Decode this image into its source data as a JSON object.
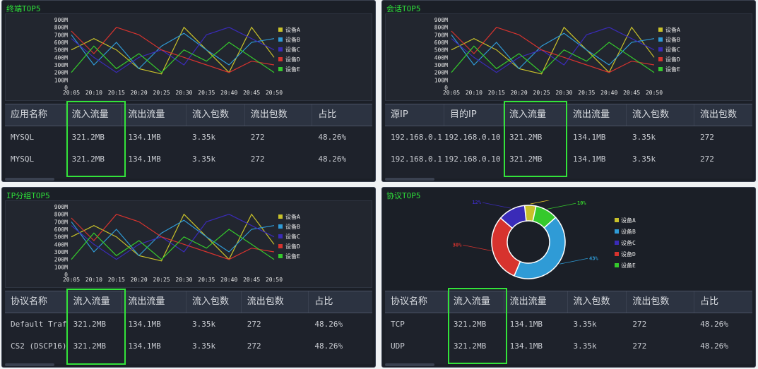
{
  "colors": {
    "series": [
      "#c8c12a",
      "#2f9bd6",
      "#3a2bb8",
      "#d7332e",
      "#35c92c"
    ],
    "highlight": "#33e33a",
    "title": "#2ee03a"
  },
  "panels": {
    "terminal": {
      "title": "终端TOP5",
      "headers": [
        "应用名称",
        "流入流量",
        "流出流量",
        "流入包数",
        "流出包数",
        "占比"
      ],
      "rows": [
        [
          "MYSQL",
          "321.2MB",
          "134.1MB",
          "3.35k",
          "272",
          "48.26%"
        ],
        [
          "MYSQL",
          "321.2MB",
          "134.1MB",
          "3.35k",
          "272",
          "48.26%"
        ]
      ]
    },
    "session": {
      "title": "会话TOP5",
      "headers": [
        "源IP",
        "目的IP",
        "流入流量",
        "流出流量",
        "流入包数",
        "流出包数"
      ],
      "rows": [
        [
          "192.168.0.1",
          "192.168.0.10",
          "321.2MB",
          "134.1MB",
          "3.35k",
          "272"
        ],
        [
          "192.168.0.1",
          "192.168.0.10",
          "321.2MB",
          "134.1MB",
          "3.35k",
          "272"
        ]
      ]
    },
    "ipgroup": {
      "title": "IP分组TOP5",
      "headers": [
        "协议名称",
        "流入流量",
        "流出流量",
        "流入包数",
        "流出包数",
        "占比"
      ],
      "rows": [
        [
          "Default Traff",
          "321.2MB",
          "134.1MB",
          "3.35k",
          "272",
          "48.26%"
        ],
        [
          "CS2 (DSCP16)",
          "321.2MB",
          "134.1MB",
          "3.35k",
          "272",
          "48.26%"
        ]
      ]
    },
    "protocol": {
      "title": "协议TOP5",
      "headers": [
        "协议名称",
        "流入流量",
        "流出流量",
        "流入包数",
        "流出包数",
        "占比"
      ],
      "rows": [
        [
          "TCP",
          "321.2MB",
          "134.1MB",
          "3.35k",
          "272",
          "48.26%"
        ],
        [
          "UDP",
          "321.2MB",
          "134.1MB",
          "3.35k",
          "272",
          "48.26%"
        ]
      ]
    }
  },
  "chart_data": [
    {
      "type": "line",
      "x": [
        "20:05",
        "20:10",
        "20:15",
        "20:20",
        "20:25",
        "20:30",
        "20:35",
        "20:40",
        "20:45",
        "20:50"
      ],
      "yticks": [
        "900M",
        "800M",
        "700M",
        "600M",
        "500M",
        "400M",
        "300M",
        "200M",
        "100M",
        "0"
      ],
      "ylim": [
        0,
        900
      ],
      "legend_position": "right",
      "series": [
        {
          "name": "设备A",
          "values": [
            500,
            650,
            500,
            250,
            180,
            800,
            500,
            200,
            800,
            400
          ]
        },
        {
          "name": "设备B",
          "values": [
            700,
            300,
            600,
            250,
            550,
            720,
            500,
            300,
            600,
            650
          ]
        },
        {
          "name": "设备C",
          "values": [
            650,
            400,
            200,
            400,
            500,
            300,
            700,
            800,
            650,
            500
          ]
        },
        {
          "name": "设备D",
          "values": [
            750,
            450,
            800,
            700,
            500,
            400,
            300,
            200,
            350,
            300
          ]
        },
        {
          "name": "设备E",
          "values": [
            200,
            550,
            250,
            450,
            200,
            500,
            350,
            600,
            400,
            200
          ]
        }
      ]
    },
    {
      "type": "line",
      "x": [
        "20:05",
        "20:10",
        "20:15",
        "20:20",
        "20:25",
        "20:30",
        "20:35",
        "20:40",
        "20:45",
        "20:50"
      ],
      "yticks": [
        "900M",
        "800M",
        "700M",
        "600M",
        "500M",
        "400M",
        "300M",
        "200M",
        "100M",
        "0"
      ],
      "ylim": [
        0,
        900
      ],
      "legend_position": "right",
      "series": [
        {
          "name": "设备A",
          "values": [
            500,
            650,
            500,
            250,
            180,
            800,
            500,
            200,
            800,
            400
          ]
        },
        {
          "name": "设备B",
          "values": [
            700,
            300,
            600,
            250,
            550,
            720,
            500,
            300,
            600,
            650
          ]
        },
        {
          "name": "设备C",
          "values": [
            650,
            400,
            200,
            400,
            500,
            300,
            700,
            800,
            650,
            500
          ]
        },
        {
          "name": "设备D",
          "values": [
            750,
            450,
            800,
            700,
            500,
            400,
            300,
            200,
            350,
            300
          ]
        },
        {
          "name": "设备E",
          "values": [
            200,
            550,
            250,
            450,
            200,
            500,
            350,
            600,
            400,
            200
          ]
        }
      ]
    },
    {
      "type": "line",
      "x": [
        "20:05",
        "20:10",
        "20:15",
        "20:20",
        "20:25",
        "20:30",
        "20:35",
        "20:40",
        "20:45",
        "20:50"
      ],
      "yticks": [
        "900M",
        "800M",
        "700M",
        "600M",
        "500M",
        "400M",
        "300M",
        "200M",
        "100M",
        "0"
      ],
      "ylim": [
        0,
        900
      ],
      "legend_position": "right",
      "series": [
        {
          "name": "设备A",
          "values": [
            500,
            650,
            500,
            250,
            180,
            800,
            500,
            200,
            800,
            400
          ]
        },
        {
          "name": "设备B",
          "values": [
            700,
            300,
            600,
            250,
            550,
            720,
            500,
            300,
            600,
            650
          ]
        },
        {
          "name": "设备C",
          "values": [
            650,
            400,
            200,
            400,
            500,
            300,
            700,
            800,
            650,
            500
          ]
        },
        {
          "name": "设备D",
          "values": [
            750,
            450,
            800,
            700,
            500,
            400,
            300,
            200,
            350,
            300
          ]
        },
        {
          "name": "设备E",
          "values": [
            200,
            550,
            250,
            450,
            200,
            500,
            350,
            600,
            400,
            200
          ]
        }
      ]
    },
    {
      "type": "pie",
      "donut": true,
      "legend_position": "right",
      "slices": [
        {
          "name": "设备A",
          "label": "5%",
          "value": 5
        },
        {
          "name": "设备B",
          "label": "43%",
          "value": 43
        },
        {
          "name": "设备C",
          "label": "12%",
          "value": 12
        },
        {
          "name": "设备D",
          "label": "30%",
          "value": 30
        },
        {
          "name": "设备E",
          "label": "10%",
          "value": 10
        }
      ]
    }
  ]
}
